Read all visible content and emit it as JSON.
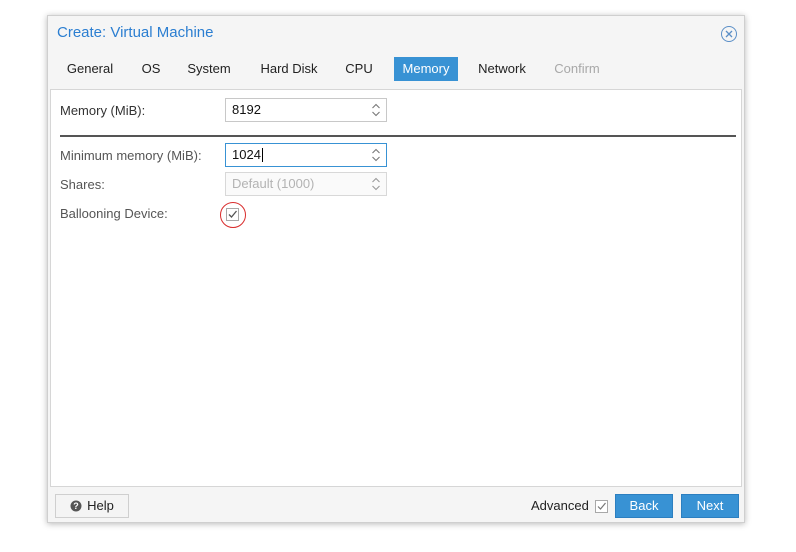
{
  "window": {
    "title": "Create: Virtual Machine"
  },
  "tabs": [
    {
      "label": "General",
      "state": "normal"
    },
    {
      "label": "OS",
      "state": "normal"
    },
    {
      "label": "System",
      "state": "normal"
    },
    {
      "label": "Hard Disk",
      "state": "normal"
    },
    {
      "label": "CPU",
      "state": "normal"
    },
    {
      "label": "Memory",
      "state": "active"
    },
    {
      "label": "Network",
      "state": "normal"
    },
    {
      "label": "Confirm",
      "state": "disabled"
    }
  ],
  "form": {
    "memory": {
      "label": "Memory (MiB):",
      "value": "8192"
    },
    "min_memory": {
      "label": "Minimum memory (MiB):",
      "value": "1024"
    },
    "shares": {
      "label": "Shares:",
      "placeholder": "Default (1000)"
    },
    "ballooning": {
      "label": "Ballooning Device:",
      "checked": true
    }
  },
  "footer": {
    "help_label": "Help",
    "advanced_label": "Advanced",
    "advanced_checked": true,
    "back_label": "Back",
    "next_label": "Next"
  },
  "colors": {
    "accent": "#3892d4",
    "title": "#2b7ed1",
    "highlight": "#d92c2c"
  },
  "icons": {
    "close": "close-circle-icon",
    "help": "question-circle-icon",
    "spinner": "spinner-arrows-icon",
    "checkmark": "checkmark-icon"
  }
}
